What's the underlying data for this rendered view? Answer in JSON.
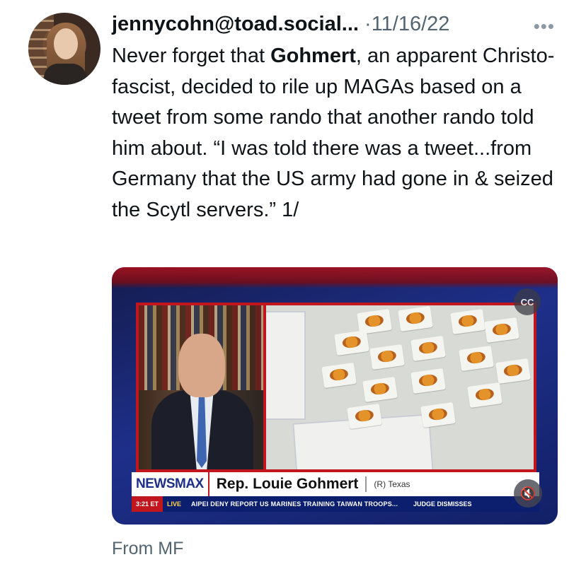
{
  "post": {
    "handle": "jennycohn@toad.social...",
    "separator": "·",
    "date": "11/16/22",
    "more_icon": "more-horizontal-icon",
    "text_before_bold": "Never forget that ",
    "text_bold": "Gohmert",
    "text_after_bold": ", an apparent Christo-fascist, decided to rile up MAGAs based on a tweet from some rando that another rando told him about. “I was told there was a tweet...from Germany that the US army had gone in & seized the Scytl servers.” 1/",
    "footer": "From MF"
  },
  "media": {
    "cc_label": "CC",
    "brand": "NEWSMAX",
    "lower_third_name": "Rep. Louie Gohmert",
    "lower_third_party": "(R) Texas",
    "ticker_time": "3:21 ET",
    "ticker_live": "LIVE",
    "ticker_text": "AIPEI DENY REPORT US MARINES TRAINING TAIWAN TROOPS...",
    "ticker_tail": "JUDGE DISMISSES",
    "mute_glyph": "🔇"
  },
  "colors": {
    "text": "#0f1419",
    "secondary": "#536471",
    "newsmax_red": "#c2161f",
    "newsmax_blue": "#1e2f8a"
  }
}
